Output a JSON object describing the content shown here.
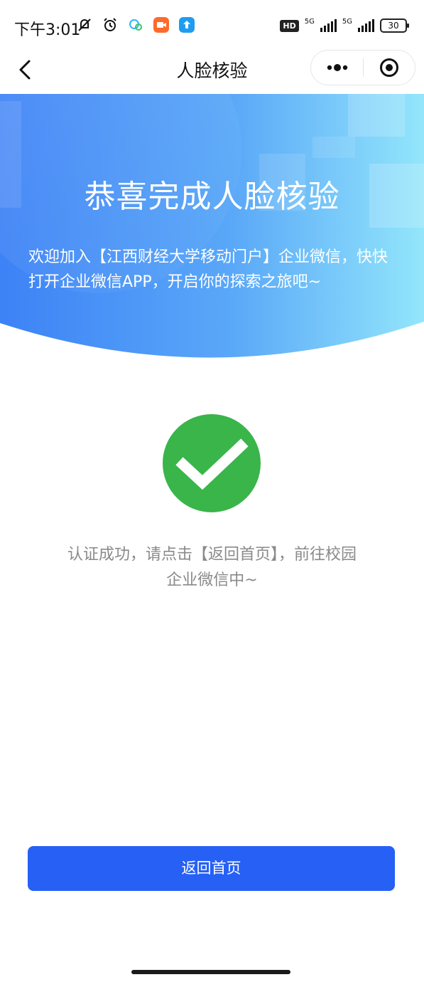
{
  "status_bar": {
    "time": "下午3:01",
    "hd_label": "HD",
    "network_1": "5G",
    "network_2": "5G",
    "battery": "30"
  },
  "nav": {
    "title": "人脸核验"
  },
  "hero": {
    "title": "恭喜完成人脸核验",
    "description": "欢迎加入【江西财经大学移动门户】企业微信，快快打开企业微信APP，开启你的探索之旅吧~"
  },
  "result": {
    "message_line1": "认证成功，请点击【返回首页】，前往校园",
    "message_line2": "企业微信中~"
  },
  "actions": {
    "back_home_label": "返回首页"
  },
  "colors": {
    "primary": "#2660f5",
    "success": "#39b54a",
    "hero_start": "#3f86f7",
    "hero_end": "#8fe4fb"
  },
  "icons": [
    "back-icon",
    "more-icon",
    "close-target-icon",
    "checkmark-icon",
    "alarm-icon",
    "mute-icon"
  ]
}
